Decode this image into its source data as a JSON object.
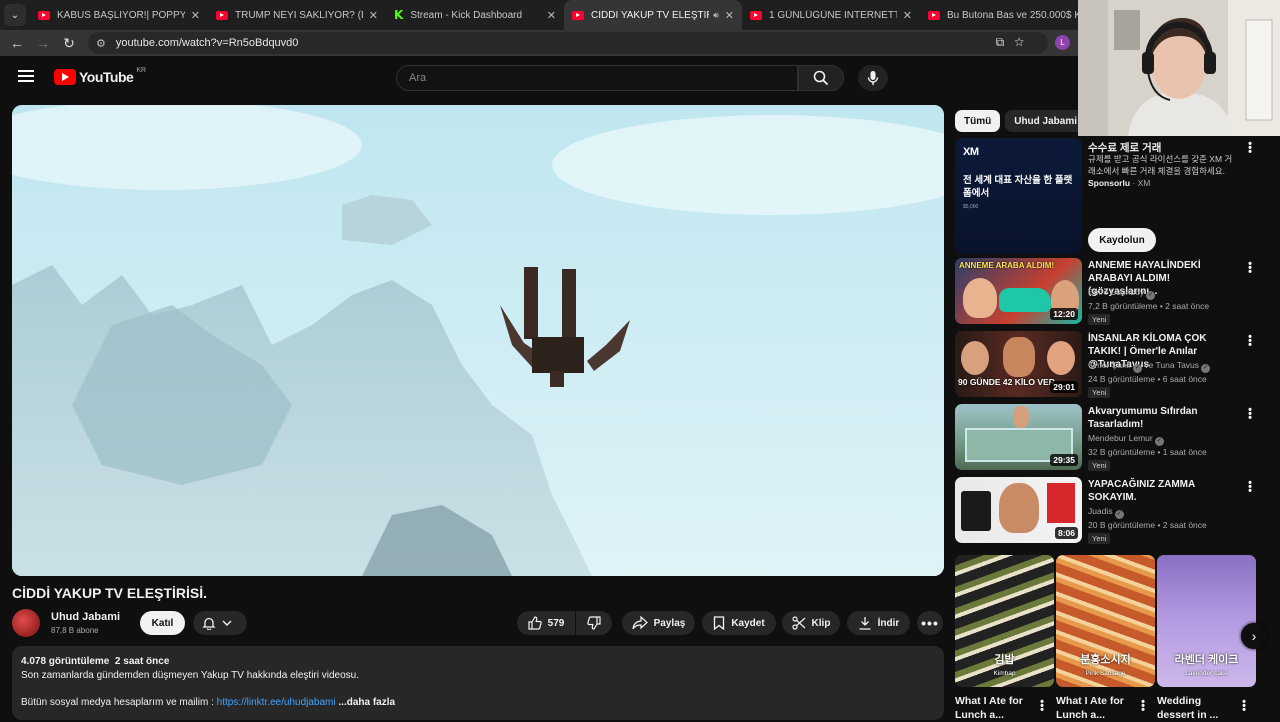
{
  "browser": {
    "tabs": [
      {
        "title": "KÂBUS BAŞLIYOR!| POPPY PLAY",
        "favicon": "youtube-icon",
        "active": false
      },
      {
        "title": "TRUMP NEYİ SAKLIYOR? (Epste",
        "favicon": "youtube-icon",
        "active": false
      },
      {
        "title": "Stream - Kick Dashboard",
        "favicon": "kick-icon",
        "active": false
      },
      {
        "title": "CİDDİ YAKUP TV ELEŞTİRİSİ",
        "favicon": "youtube-icon",
        "active": true,
        "audio": true
      },
      {
        "title": "1 GÜNLÜĞÜNE İNTERNETTE Ç",
        "favicon": "youtube-icon",
        "active": false
      },
      {
        "title": "Bu Butona Bas ve 250.000$ Kaz",
        "favicon": "youtube-icon",
        "active": false
      }
    ],
    "url": "youtube.com/watch?v=Rn5oBdquvd0"
  },
  "header": {
    "logo_text": "YouTube",
    "country_code": "KR",
    "search_placeholder": "Ara"
  },
  "video": {
    "title": "CİDDİ YAKUP TV ELEŞTİRİSİ.",
    "channel": "Uhud Jabami",
    "subscribers": "87,8 B abone",
    "join_label": "Katıl",
    "likes": "579",
    "share_label": "Paylaş",
    "save_label": "Kaydet",
    "clip_label": "Klip",
    "download_label": "İndir"
  },
  "description": {
    "stats": "4.078 görüntüleme  2 saat önce",
    "line1": "Son zamanlarda gündemden düşmeyen Yakup TV hakkında eleştiri videosu.",
    "line2_prefix": "Bütün sosyal medya hesaplarım ve mailim : ",
    "link": "https://linktr.ee/uhudjabami",
    "more": " ...daha fazla"
  },
  "sidebar": {
    "chips": [
      "Tümü",
      "Uhud Jabami"
    ],
    "ad": {
      "brand_logo": "XM",
      "thumb_text": "전 세계 대표 자산을 한 플랫폼에서",
      "thumb_sub": "$5,000",
      "title": "수수료 제로 거래",
      "description": "규제를 받고 공식 라이선스를 갖춘 XM 거래소에서 빠른 거래 체결을 경험하세요.",
      "sponsored": "Sponsorlu",
      "advertiser": "XM",
      "cta": "Kaydolun"
    },
    "recommendations": [
      {
        "title": "ANNEME HAYALİNDEKİ ARABAYI ALDIM! (gözyaşlarını...",
        "channel": "Emre Uzunboy",
        "meta": "7,2 B görüntüleme • 2 saat önce",
        "duration": "12:20",
        "badge": "Yeni",
        "thumb_text": "ANNEME ARABA ALDIM!"
      },
      {
        "title": "İNSANLAR KİLOMA ÇOK TAKIK! | Ömer'le Anılar @TunaTavus",
        "channel": "Ömer Şanlı",
        "channel2": "ve Tuna Tavus",
        "meta": "24 B görüntüleme • 6 saat önce",
        "duration": "29:01",
        "badge": "Yeni",
        "thumb_text": "90 GÜNDE 42 KİLO VER"
      },
      {
        "title": "Akvaryumumu Sıfırdan Tasarladım!",
        "channel": "Mendebur Lemur",
        "meta": "32 B görüntüleme • 1 saat önce",
        "duration": "29:35",
        "badge": "Yeni",
        "thumb_text": ""
      },
      {
        "title": "YAPACAĞINIZ ZAMMA SOKAYIM.",
        "channel": "Juadis",
        "meta": "20 B görüntüleme • 2 saat önce",
        "duration": "8:06",
        "badge": "Yeni",
        "thumb_text": ""
      }
    ],
    "shorts": [
      {
        "title": "What I Ate for Lunch a...",
        "label": "김밥",
        "sublabel": "Kimbap"
      },
      {
        "title": "What I Ate for Lunch a...",
        "label": "분홍소시지",
        "sublabel": "Pink Sausage"
      },
      {
        "title": "Wedding dessert in ...",
        "label": "라벤더 케이크",
        "sublabel": "Lavender cake"
      }
    ]
  },
  "colors": {
    "youtube_red": "#ff0000",
    "link_blue": "#3ea6ff",
    "kick_green": "#53fc18",
    "background": "#0f0f0f"
  }
}
